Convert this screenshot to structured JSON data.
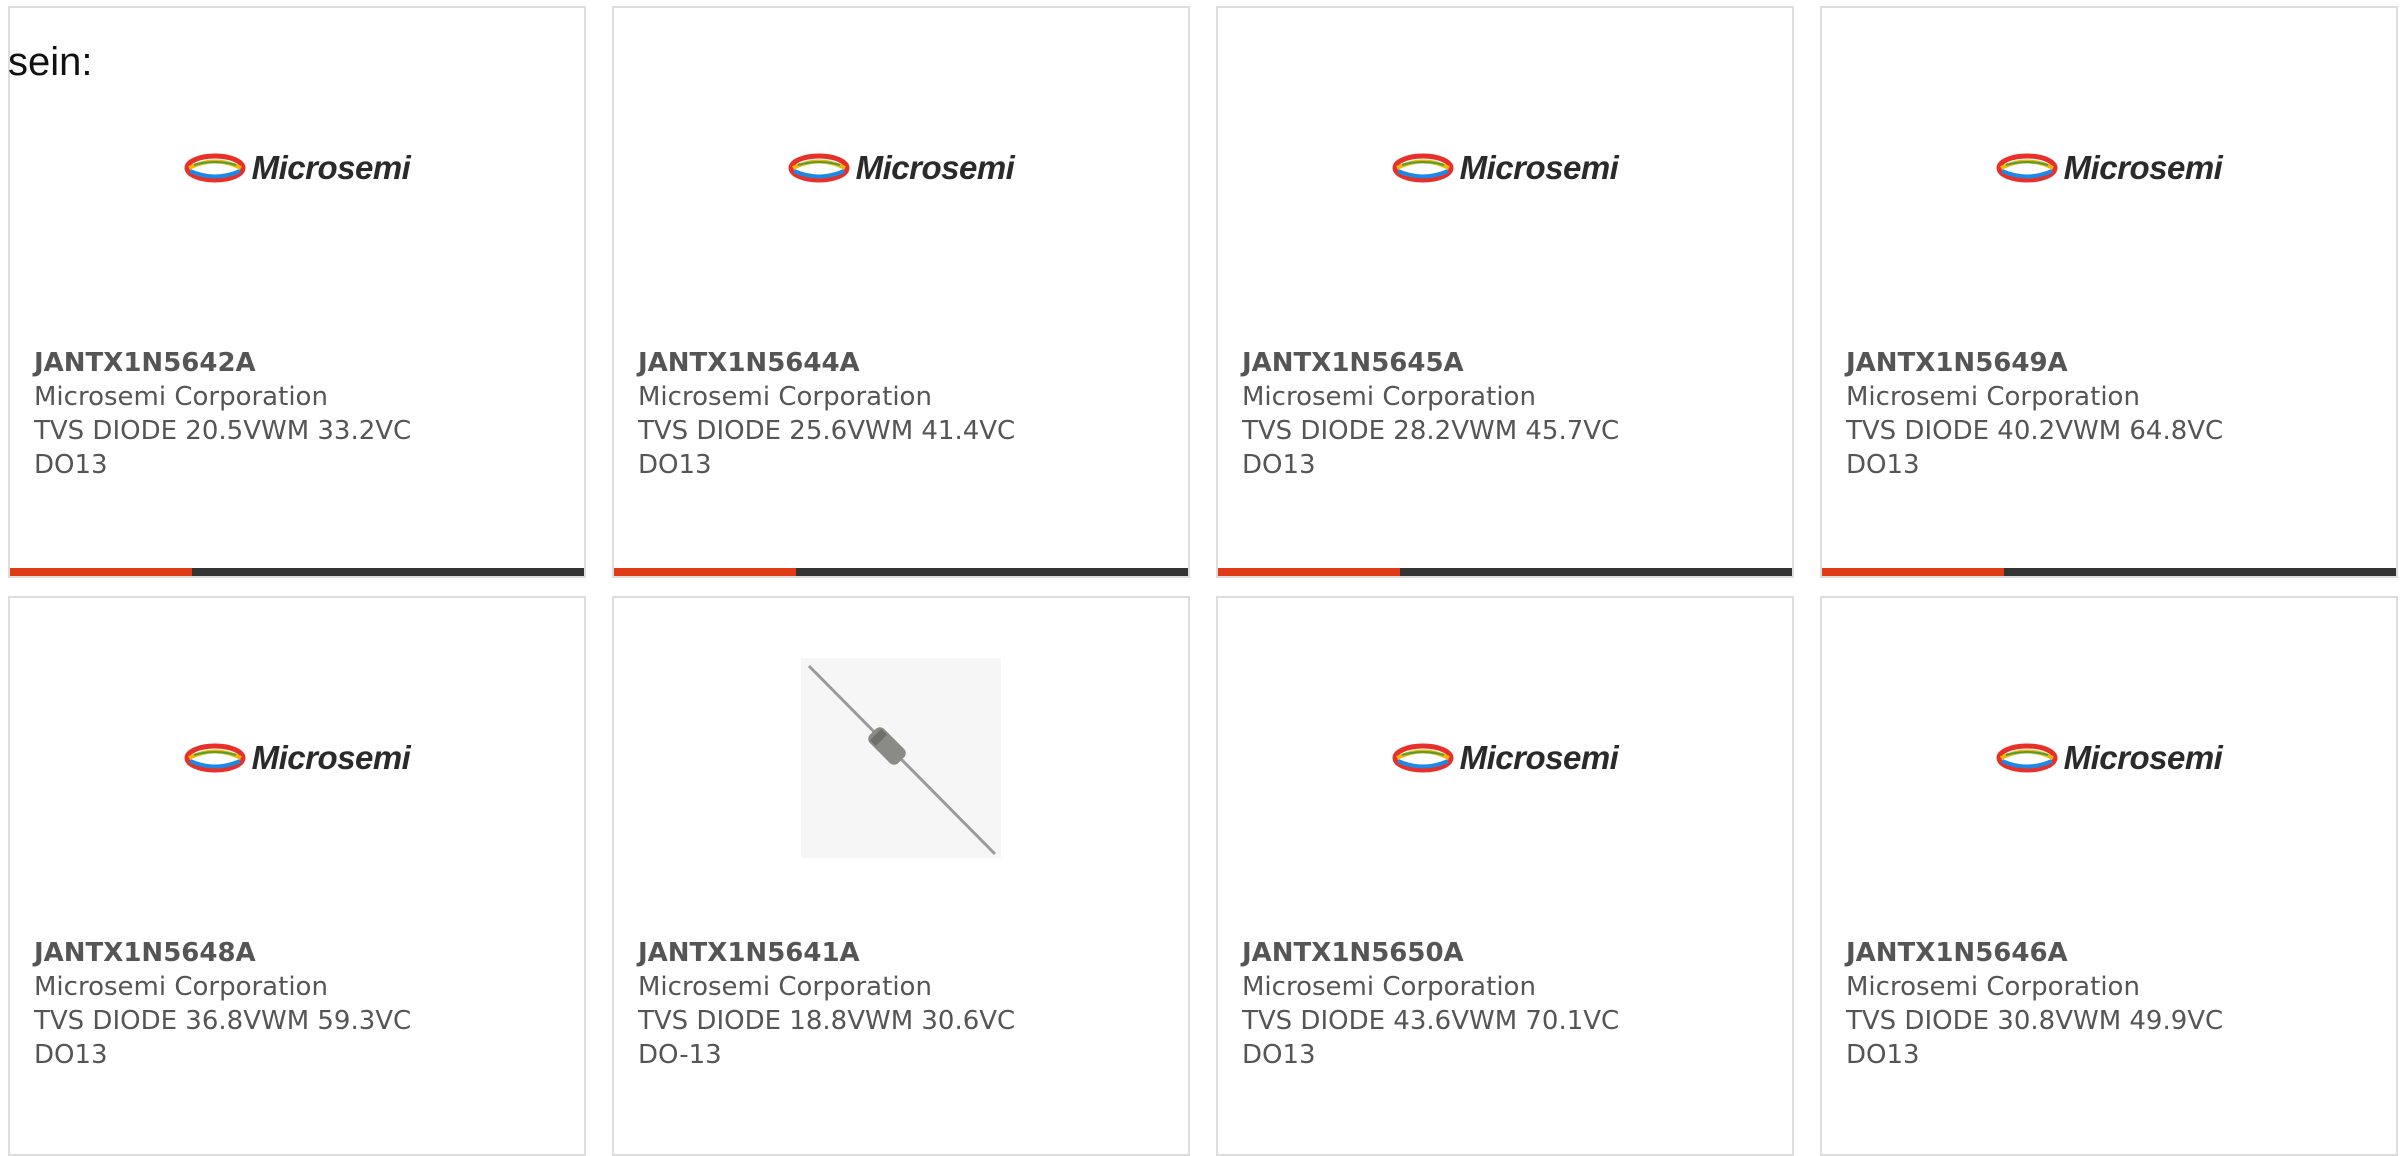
{
  "intro": {
    "text": "sein:"
  },
  "colors": {
    "accent": "#e03a16",
    "bar": "#333333",
    "text": "#555555",
    "border": "#dddddd"
  },
  "products": [
    {
      "part": "JANTX1N5642A",
      "manufacturer": "Microsemi Corporation",
      "description": "TVS DIODE 20.5VWM 33.2VC DO13",
      "image": "microsemi-logo",
      "logo_text": "Microsemi"
    },
    {
      "part": "JANTX1N5644A",
      "manufacturer": "Microsemi Corporation",
      "description": "TVS DIODE 25.6VWM 41.4VC DO13",
      "image": "microsemi-logo",
      "logo_text": "Microsemi"
    },
    {
      "part": "JANTX1N5645A",
      "manufacturer": "Microsemi Corporation",
      "description": "TVS DIODE 28.2VWM 45.7VC DO13",
      "image": "microsemi-logo",
      "logo_text": "Microsemi"
    },
    {
      "part": "JANTX1N5649A",
      "manufacturer": "Microsemi Corporation",
      "description": "TVS DIODE 40.2VWM 64.8VC DO13",
      "image": "microsemi-logo",
      "logo_text": "Microsemi"
    },
    {
      "part": "JANTX1N5648A",
      "manufacturer": "Microsemi Corporation",
      "description": "TVS DIODE 36.8VWM 59.3VC DO13",
      "image": "microsemi-logo",
      "logo_text": "Microsemi"
    },
    {
      "part": "JANTX1N5641A",
      "manufacturer": "Microsemi Corporation",
      "description": "TVS DIODE 18.8VWM 30.6VC DO-13",
      "image": "axial-diode-photo"
    },
    {
      "part": "JANTX1N5650A",
      "manufacturer": "Microsemi Corporation",
      "description": "TVS DIODE 43.6VWM 70.1VC DO13",
      "image": "microsemi-logo",
      "logo_text": "Microsemi"
    },
    {
      "part": "JANTX1N5646A",
      "manufacturer": "Microsemi Corporation",
      "description": "TVS DIODE 30.8VWM 49.9VC DO13",
      "image": "microsemi-logo",
      "logo_text": "Microsemi"
    }
  ]
}
